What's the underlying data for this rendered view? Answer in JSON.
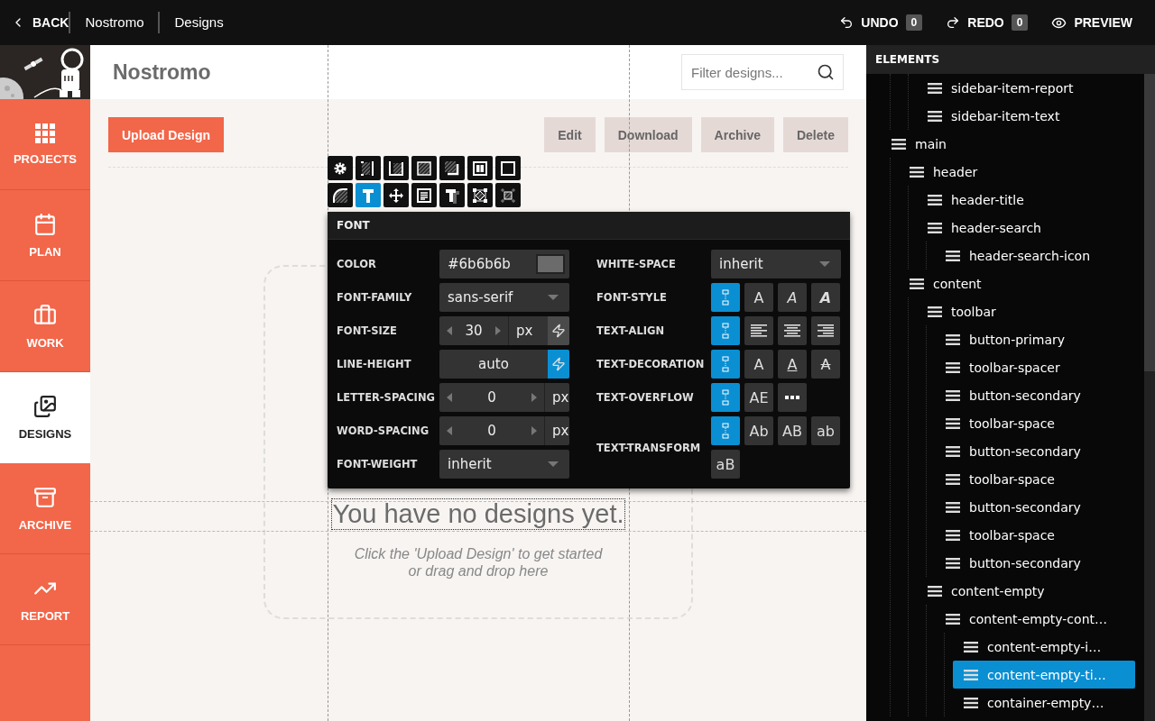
{
  "topbar": {
    "back": "BACK",
    "crumbs": [
      "Nostromo",
      "Designs"
    ],
    "undo": {
      "label": "UNDO",
      "count": "0"
    },
    "redo": {
      "label": "REDO",
      "count": "0"
    },
    "preview": "PREVIEW"
  },
  "sidebar": {
    "items": [
      {
        "kind": "projects",
        "label": "PROJECTS",
        "selected": false
      },
      {
        "kind": "plan",
        "label": "PLAN",
        "selected": false
      },
      {
        "kind": "work",
        "label": "WORK",
        "selected": false
      },
      {
        "kind": "designs",
        "label": "DESIGNS",
        "selected": true
      },
      {
        "kind": "archive",
        "label": "ARCHIVE",
        "selected": false
      },
      {
        "kind": "report",
        "label": "REPORT",
        "selected": false
      }
    ]
  },
  "header": {
    "title": "Nostromo",
    "search": {
      "placeholder": "Filter designs..."
    }
  },
  "toolbar": {
    "primary": "Upload Design",
    "secondary": [
      "Edit",
      "Download",
      "Archive",
      "Delete"
    ]
  },
  "empty": {
    "title": "You have no designs yet.",
    "subtitle": "Click the 'Upload Design' to get started\nor drag and drop here"
  },
  "style_tools": [
    {
      "kind": "gear",
      "selected": false
    },
    {
      "kind": "pad-right",
      "selected": false
    },
    {
      "kind": "pad-left",
      "selected": false
    },
    {
      "kind": "fill",
      "selected": false
    },
    {
      "kind": "shadow",
      "selected": false
    },
    {
      "kind": "columns",
      "selected": false
    },
    {
      "kind": "border",
      "selected": false
    },
    {
      "kind": "radius",
      "selected": false
    },
    {
      "kind": "text",
      "selected": true
    },
    {
      "kind": "move",
      "selected": false
    },
    {
      "kind": "paragraph",
      "selected": false
    },
    {
      "kind": "text-shadow",
      "selected": false
    },
    {
      "kind": "transform",
      "selected": false
    },
    {
      "kind": "crop",
      "selected": false
    }
  ],
  "font_panel": {
    "title": "FONT",
    "left": [
      {
        "kind": "color",
        "label": "COLOR",
        "value": "#6b6b6b",
        "color": "#6b6b6b"
      },
      {
        "kind": "select",
        "label": "FONT-FAMILY",
        "value": "sans-serif"
      },
      {
        "kind": "stepper",
        "label": "FONT-SIZE",
        "value": "30",
        "unit": "px",
        "bolt": {
          "active": false
        }
      },
      {
        "kind": "plain",
        "label": "LINE-HEIGHT",
        "value": "auto",
        "bolt": {
          "active": true
        }
      },
      {
        "kind": "stepper",
        "label": "LETTER-SPACING",
        "value": "0",
        "unit": "px"
      },
      {
        "kind": "stepper",
        "label": "WORD-SPACING",
        "value": "0",
        "unit": "px"
      },
      {
        "kind": "select",
        "label": "FONT-WEIGHT",
        "value": "inherit"
      }
    ],
    "right": [
      {
        "kind": "select",
        "label": "WHITE-SPACE",
        "value": "inherit"
      },
      {
        "kind": "options",
        "label": "FONT-STYLE",
        "options": [
          {
            "kind": "inherit",
            "selected": true
          },
          {
            "kind": "glyph",
            "label": "A",
            "selected": false
          },
          {
            "kind": "italic",
            "label": "A",
            "selected": false
          },
          {
            "kind": "bold-italic",
            "label": "A",
            "selected": false
          }
        ]
      },
      {
        "kind": "options",
        "label": "TEXT-ALIGN",
        "options": [
          {
            "kind": "inherit",
            "selected": true
          },
          {
            "kind": "align-left",
            "selected": false
          },
          {
            "kind": "align-center",
            "selected": false
          },
          {
            "kind": "align-right",
            "selected": false
          }
        ]
      },
      {
        "kind": "options",
        "label": "TEXT-DECORATION",
        "options": [
          {
            "kind": "inherit",
            "selected": true
          },
          {
            "kind": "glyph",
            "label": "A",
            "selected": false
          },
          {
            "kind": "underline",
            "label": "A",
            "selected": false
          },
          {
            "kind": "strike",
            "label": "A",
            "selected": false
          }
        ]
      },
      {
        "kind": "options",
        "label": "TEXT-OVERFLOW",
        "options": [
          {
            "kind": "inherit",
            "selected": true
          },
          {
            "kind": "glyph",
            "label": "AE",
            "selected": false
          },
          {
            "kind": "ellipsis",
            "selected": false
          }
        ]
      },
      {
        "kind": "options",
        "label": "TEXT-TRANSFORM",
        "options": [
          {
            "kind": "inherit",
            "selected": true
          },
          {
            "kind": "glyph",
            "label": "Ab",
            "selected": false
          },
          {
            "kind": "glyph",
            "label": "AB",
            "selected": false
          },
          {
            "kind": "glyph",
            "label": "ab",
            "selected": false
          },
          {
            "kind": "glyph",
            "label": "aB",
            "selected": false
          }
        ]
      }
    ]
  },
  "elements": {
    "title": "ELEMENTS",
    "tree": [
      {
        "children": [
          {
            "children": [
              {
                "label": "sidebar-item-report",
                "selected": false
              },
              {
                "label": "sidebar-item-text",
                "selected": false
              }
            ]
          }
        ]
      },
      {
        "label": "main",
        "selected": false,
        "children": [
          {
            "label": "header",
            "selected": false,
            "children": [
              {
                "label": "header-title",
                "selected": false
              },
              {
                "label": "header-search",
                "selected": false,
                "children": [
                  {
                    "label": "header-search-icon",
                    "selected": false
                  }
                ]
              }
            ]
          },
          {
            "label": "content",
            "selected": false,
            "children": [
              {
                "label": "toolbar",
                "selected": false,
                "children": [
                  {
                    "label": "button-primary",
                    "selected": false
                  },
                  {
                    "label": "toolbar-spacer",
                    "selected": false
                  },
                  {
                    "label": "button-secondary",
                    "selected": false
                  },
                  {
                    "label": "toolbar-space",
                    "selected": false
                  },
                  {
                    "label": "button-secondary",
                    "selected": false
                  },
                  {
                    "label": "toolbar-space",
                    "selected": false
                  },
                  {
                    "label": "button-secondary",
                    "selected": false
                  },
                  {
                    "label": "toolbar-space",
                    "selected": false
                  },
                  {
                    "label": "button-secondary",
                    "selected": false
                  }
                ]
              },
              {
                "label": "content-empty",
                "selected": false,
                "children": [
                  {
                    "label": "content-empty-cont…",
                    "selected": false,
                    "children": [
                      {
                        "label": "content-empty-i…",
                        "selected": false
                      },
                      {
                        "label": "content-empty-ti…",
                        "selected": true
                      },
                      {
                        "label": "container-empty…",
                        "selected": false
                      }
                    ]
                  }
                ]
              }
            ]
          }
        ]
      }
    ]
  }
}
